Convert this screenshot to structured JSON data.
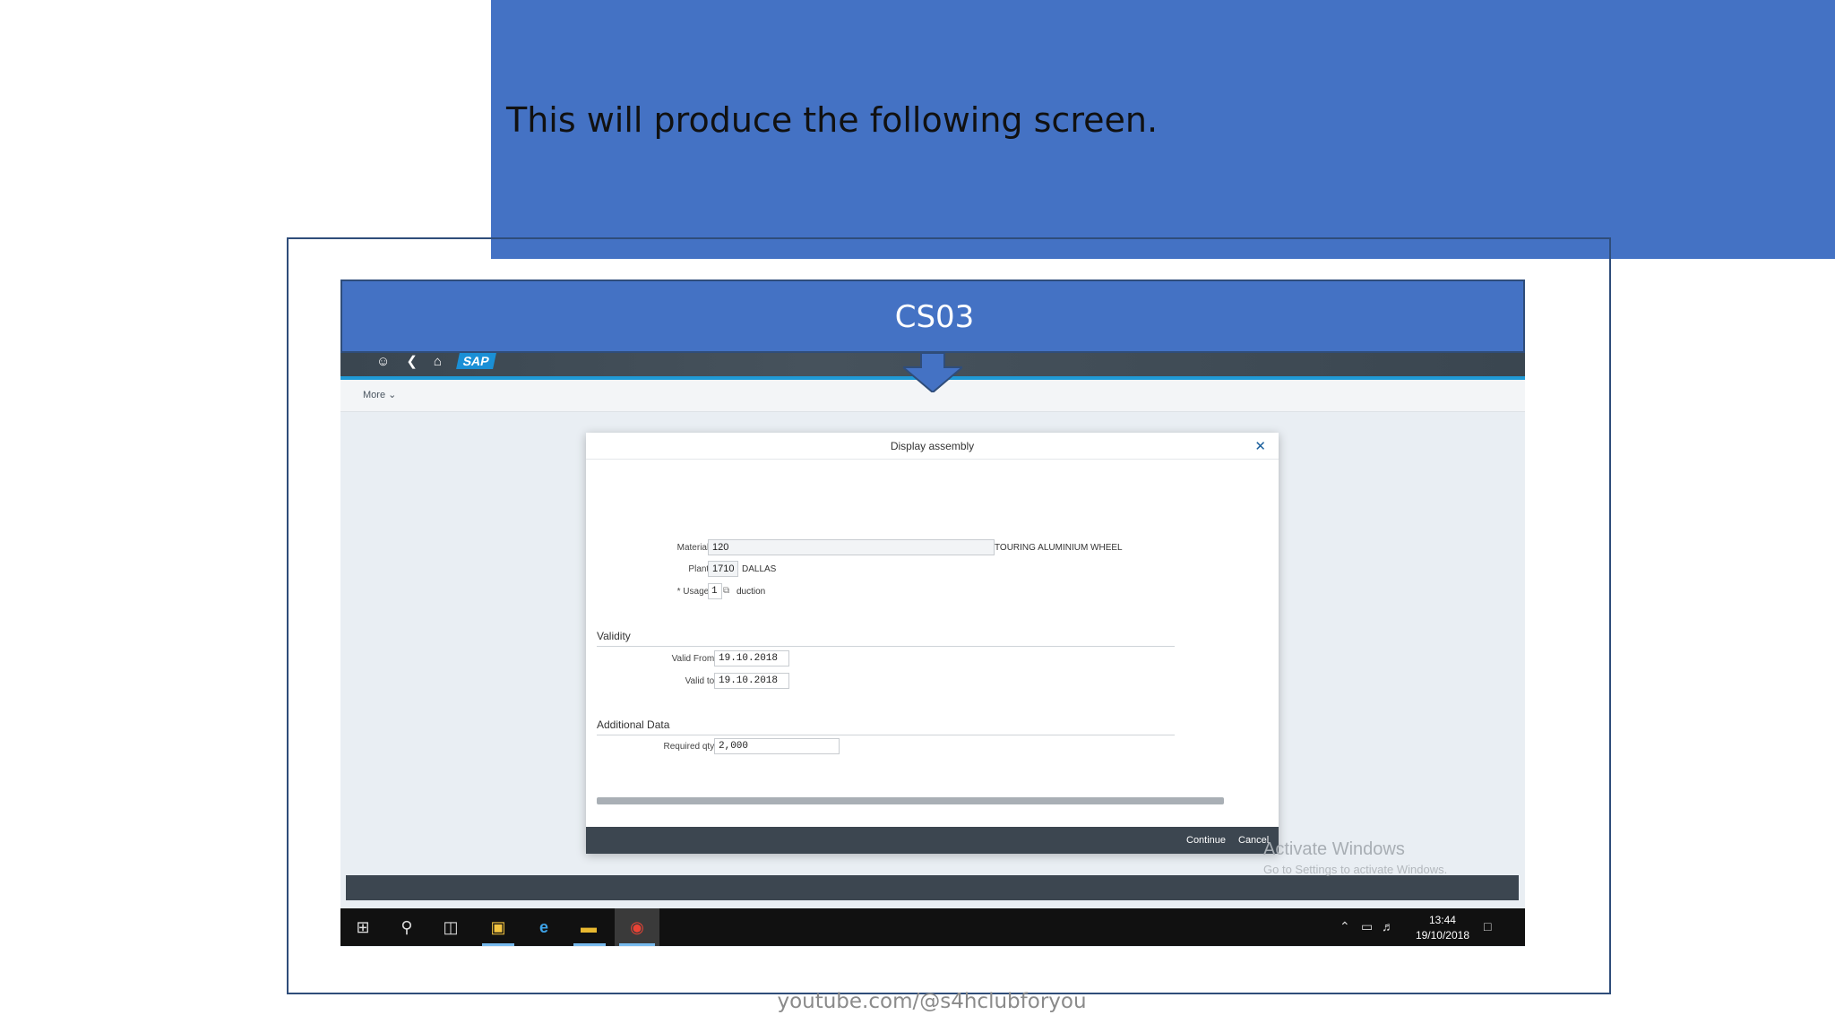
{
  "banner": {
    "text": "This will produce the following screen."
  },
  "callout": {
    "title": "CS03"
  },
  "shell": {
    "logo": "SAP",
    "more": "More"
  },
  "dialog": {
    "title": "Display assembly",
    "material_label": "Material:",
    "material_value": "120",
    "material_desc": "TOURING ALUMINIUM WHEEL",
    "plant_label": "Plant:",
    "plant_value": "1710",
    "plant_desc": "DALLAS",
    "usage_label": "* Usage:",
    "usage_value": "1",
    "usage_desc": "duction",
    "validity_title": "Validity",
    "valid_from_label": "Valid From:",
    "valid_from_value": "19.10.2018",
    "valid_to_label": "Valid to:",
    "valid_to_value": "19.10.2018",
    "additional_title": "Additional Data",
    "req_qty_label": "Required qty:",
    "req_qty_value": "2,000",
    "continue_label": "Continue",
    "cancel_label": "Cancel"
  },
  "watermark": {
    "line1": "Activate Windows",
    "line2": "Go to Settings to activate Windows."
  },
  "taskbar": {
    "time": "13:44",
    "date": "19/10/2018"
  },
  "footer": {
    "text": "youtube.com/@s4hclubforyou"
  },
  "colors": {
    "banner": "#4472c4",
    "sap_accent": "#1f9ad6",
    "shell": "#3c4650"
  }
}
